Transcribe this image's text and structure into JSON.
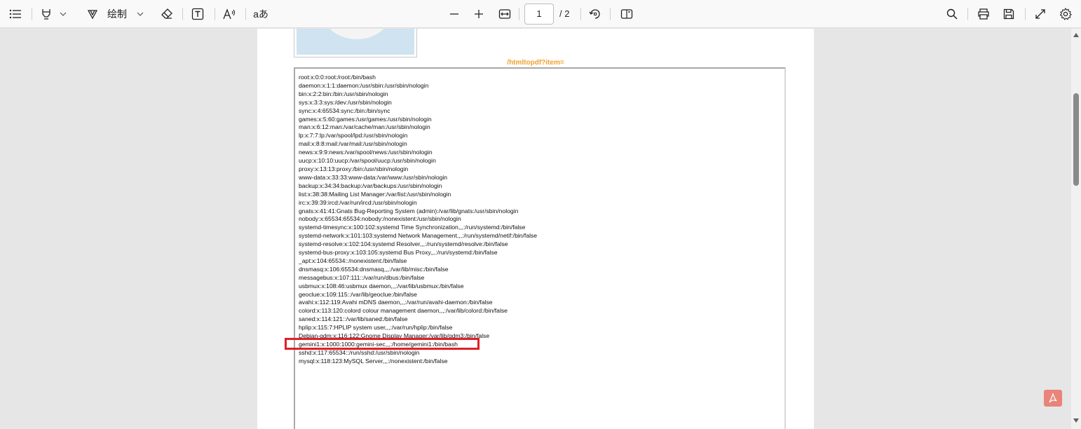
{
  "toolbar": {
    "draw_label": "绘制",
    "translate_label": "aあ",
    "page_current": "1",
    "page_total": "/ 2",
    "icons": [
      "contents-icon",
      "highlight-icon",
      "draw-icon",
      "eraser-icon",
      "text-box-icon",
      "read-aloud-icon",
      "translate-icon",
      "zoom-out-icon",
      "zoom-in-icon",
      "fit-width-icon",
      "rotate-icon",
      "page-view-icon",
      "search-icon",
      "print-icon",
      "save-icon",
      "fullscreen-icon",
      "settings-icon"
    ]
  },
  "document": {
    "frame_title": "/htmltopdf?item=",
    "lines": [
      "root:x:0:0:root:/root:/bin/bash",
      "daemon:x:1:1:daemon:/usr/sbin:/usr/sbin/nologin",
      "bin:x:2:2:bin:/bin:/usr/sbin/nologin",
      "sys:x:3:3:sys:/dev:/usr/sbin/nologin",
      "sync:x:4:65534:sync:/bin:/bin/sync",
      "games:x:5:60:games:/usr/games:/usr/sbin/nologin",
      "man:x:6:12:man:/var/cache/man:/usr/sbin/nologin",
      "lp:x:7:7:lp:/var/spool/lpd:/usr/sbin/nologin",
      "mail:x:8:8:mail:/var/mail:/usr/sbin/nologin",
      "news:x:9:9:news:/var/spool/news:/usr/sbin/nologin",
      "uucp:x:10:10:uucp:/var/spool/uucp:/usr/sbin/nologin",
      "proxy:x:13:13:proxy:/bin:/usr/sbin/nologin",
      "www-data:x:33:33:www-data:/var/www:/usr/sbin/nologin",
      "backup:x:34:34:backup:/var/backups:/usr/sbin/nologin",
      "list:x:38:38:Mailing List Manager:/var/list:/usr/sbin/nologin",
      "irc:x:39:39:ircd:/var/run/ircd:/usr/sbin/nologin",
      "gnats:x:41:41:Gnats Bug-Reporting System (admin):/var/lib/gnats:/usr/sbin/nologin",
      "nobody:x:65534:65534:nobody:/nonexistent:/usr/sbin/nologin",
      "systemd-timesync:x:100:102:systemd Time Synchronization,,,:/run/systemd:/bin/false",
      "systemd-network:x:101:103:systemd Network Management,,,:/run/systemd/netif:/bin/false",
      "systemd-resolve:x:102:104:systemd Resolver,,,:/run/systemd/resolve:/bin/false",
      "systemd-bus-proxy:x:103:105:systemd Bus Proxy,,,:/run/systemd:/bin/false",
      "_apt:x:104:65534::/nonexistent:/bin/false",
      "dnsmasq:x:106:65534:dnsmasq,,,:/var/lib/misc:/bin/false",
      "messagebus:x:107:111::/var/run/dbus:/bin/false",
      "usbmux:x:108:46:usbmux daemon,,,:/var/lib/usbmux:/bin/false",
      "geoclue:x:109:115::/var/lib/geoclue:/bin/false",
      "avahi:x:112:119:Avahi mDNS daemon,,,:/var/run/avahi-daemon:/bin/false",
      "colord:x:113:120:colord colour management daemon,,,:/var/lib/colord:/bin/false",
      "saned:x:114:121::/var/lib/saned:/bin/false",
      "hplip:x:115:7:HPLIP system user,,,:/var/run/hplip:/bin/false",
      "Debian-gdm:x:116:122:Gnome Display Manager:/var/lib/gdm3:/bin/false",
      "gemini1:x:1000:1000:gemini-sec,,,:/home/gemini1:/bin/bash",
      "sshd:x:117:65534::/run/sshd:/usr/sbin/nologin",
      "mysql:x:118:123:MySQL Server,,,:/nonexistent:/bin/false"
    ],
    "highlighted_line_index": 32,
    "highlight_color": "#e0202a"
  }
}
